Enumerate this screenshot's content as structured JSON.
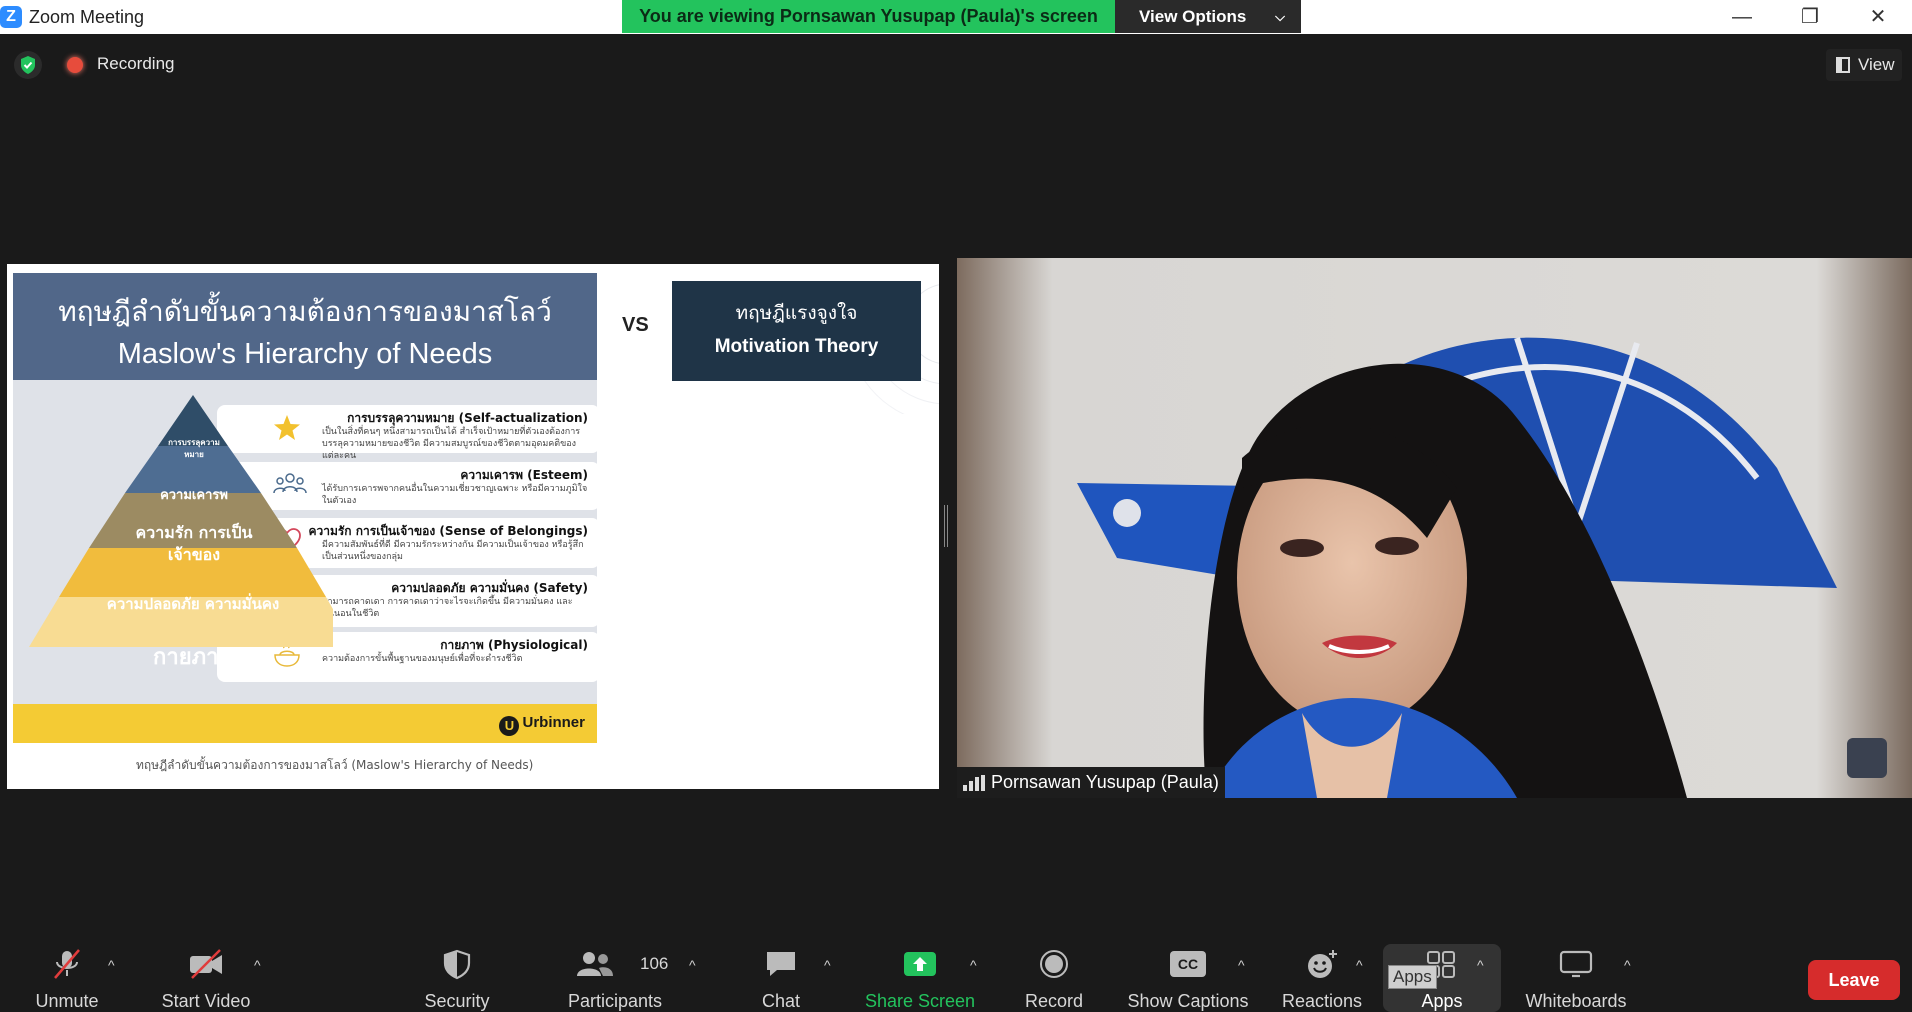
{
  "window": {
    "app_icon": "Z",
    "title": "Zoom Meeting",
    "viewing_banner": "You are viewing Pornsawan Yusupap (Paula)'s screen",
    "view_options_label": "View Options",
    "minimize_glyph": "—",
    "maximize_glyph": "❐",
    "close_glyph": "✕"
  },
  "status": {
    "recording_label": "Recording",
    "view_label": "View"
  },
  "slide": {
    "title_th": "ทฤษฎีลำดับขั้นความต้องการของมาสโลว์",
    "title_en": "Maslow's Hierarchy of Needs",
    "vs": "VS",
    "compare_th": "ทฤษฎีแรงจูงใจ",
    "compare_en": "Motivation Theory",
    "levels": [
      {
        "pyramid_label": "การบรรลุความหมาย",
        "title": "การบรรลุความหมาย (Self-actualization)",
        "desc": "เป็นในสิ่งที่คนๆ หนึ่งสามารถเป็นได้ สำเร็จเป้าหมายที่ตัวเองต้องการ บรรลุความหมายของชีวิต มีความสมบูรณ์ของชีวิตตามอุดมคติของแต่ละคน",
        "icon": "star-icon"
      },
      {
        "pyramid_label": "ความเคารพ",
        "title": "ความเคารพ (Esteem)",
        "desc": "ได้รับการเคารพจากคนอื่นในความเชี่ยวชาญเฉพาะ หรือมีความภูมิใจในตัวเอง",
        "icon": "people-icon"
      },
      {
        "pyramid_label": "ความรัก การเป็นเจ้าของ",
        "title": "ความรัก การเป็นเจ้าของ (Sense of Belongings)",
        "desc": "มีความสัมพันธ์ที่ดี มีความรักระหว่างกัน มีความเป็นเจ้าของ หรือรู้สึกเป็นส่วนหนึ่งของกลุ่ม",
        "icon": "heart-icon"
      },
      {
        "pyramid_label": "ความปลอดภัย ความมั่นคง",
        "title": "ความปลอดภัย ความมั่นคง (Safety)",
        "desc": "สามารถคาดเดา การคาดเดาว่าจะไรจะเกิดขึ้น มีความมั่นคง และแน่นอนในชีวิต",
        "icon": "shield-check-icon"
      },
      {
        "pyramid_label": "กายภาพ",
        "title": "กายภาพ (Physiological)",
        "desc": "ความต้องการขั้นพื้นฐานของมนุษย์เพื่อที่จะดำรงชีวิต",
        "icon": "food-bowl-icon"
      }
    ],
    "brand_mark": "U",
    "brand": "Urbinner",
    "caption": "ทฤษฎีลำดับขั้นความต้องการของมาสโลว์ (Maslow's Hierarchy of Needs)"
  },
  "video": {
    "participant_name": "Pornsawan Yusupap (Paula)"
  },
  "toolbar": {
    "unmute": "Unmute",
    "start_video": "Start Video",
    "security": "Security",
    "participants": "Participants",
    "participants_count": "106",
    "chat": "Chat",
    "share_screen": "Share Screen",
    "record": "Record",
    "show_captions": "Show Captions",
    "captions_icon_text": "CC",
    "reactions": "Reactions",
    "apps": "Apps",
    "apps_tooltip": "Apps",
    "whiteboards": "Whiteboards",
    "leave": "Leave",
    "caret": "^"
  },
  "colors": {
    "banner_green": "#23c35d",
    "share_green": "#23c35d",
    "leave_red": "#d62c2c",
    "slide_header": "#516789",
    "slide_footer": "#f4cb34"
  }
}
